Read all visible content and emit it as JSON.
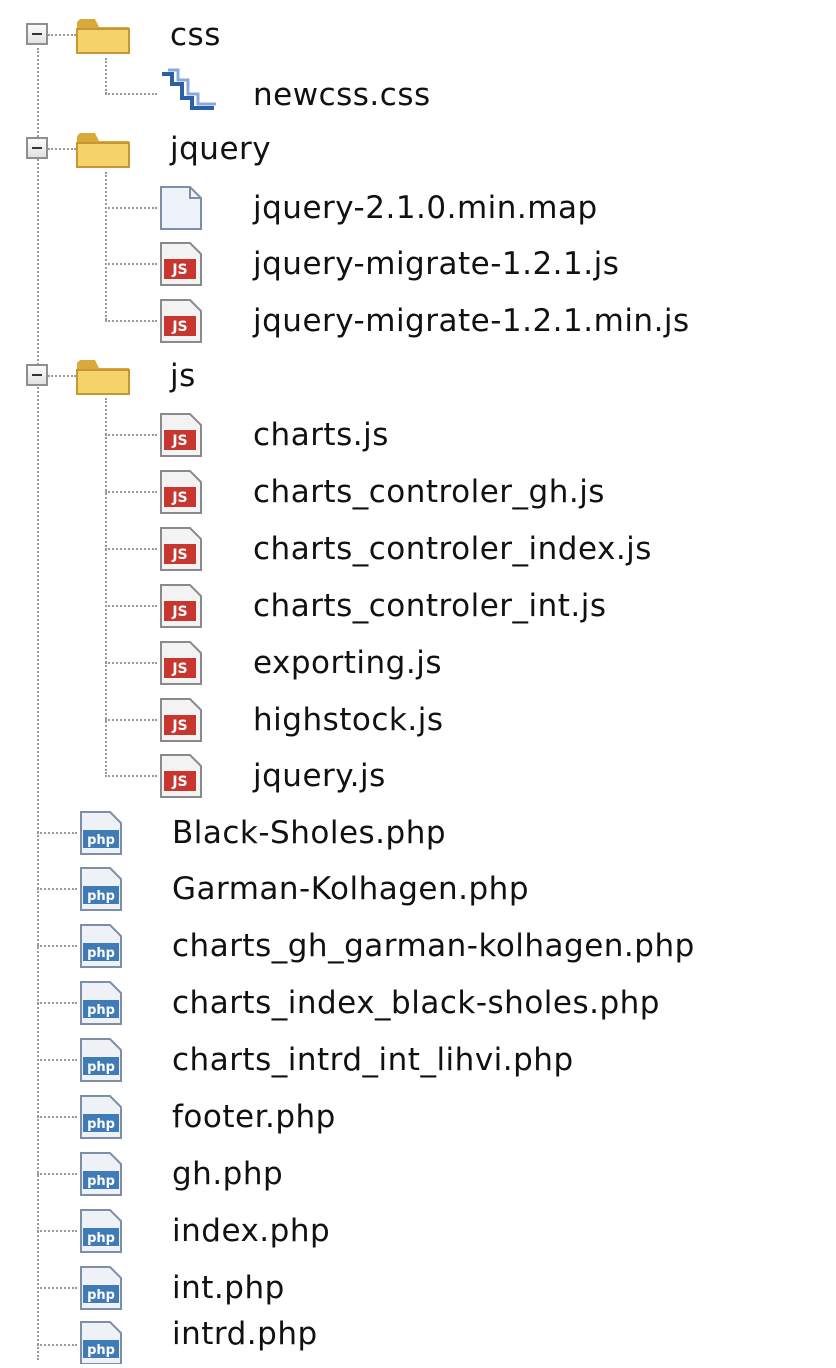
{
  "tree": {
    "folders": [
      {
        "name": "css",
        "children": [
          "newcss.css"
        ]
      },
      {
        "name": "jquery",
        "children": [
          "jquery-2.1.0.min.map",
          "jquery-migrate-1.2.1.js",
          "jquery-migrate-1.2.1.min.js"
        ]
      },
      {
        "name": "js",
        "children": [
          "charts.js",
          "charts_controler_gh.js",
          "charts_controler_index.js",
          "charts_controler_int.js",
          "exporting.js",
          "highstock.js",
          "jquery.js"
        ]
      }
    ],
    "files": [
      "Black-Sholes.php",
      "Garman-Kolhagen.php",
      "charts_gh_garman-kolhagen.php",
      "charts_index_black-sholes.php",
      "charts_intrd_int_lihvi.php",
      "footer.php",
      "gh.php",
      "index.php",
      "int.php",
      "intrd.php"
    ],
    "icon_labels": {
      "js": "JS",
      "php": "php"
    },
    "colors": {
      "folder": "#f4d36a",
      "folder_dark": "#d9a93a",
      "js_red": "#c8372f",
      "php_blue": "#3f7bb7"
    }
  }
}
